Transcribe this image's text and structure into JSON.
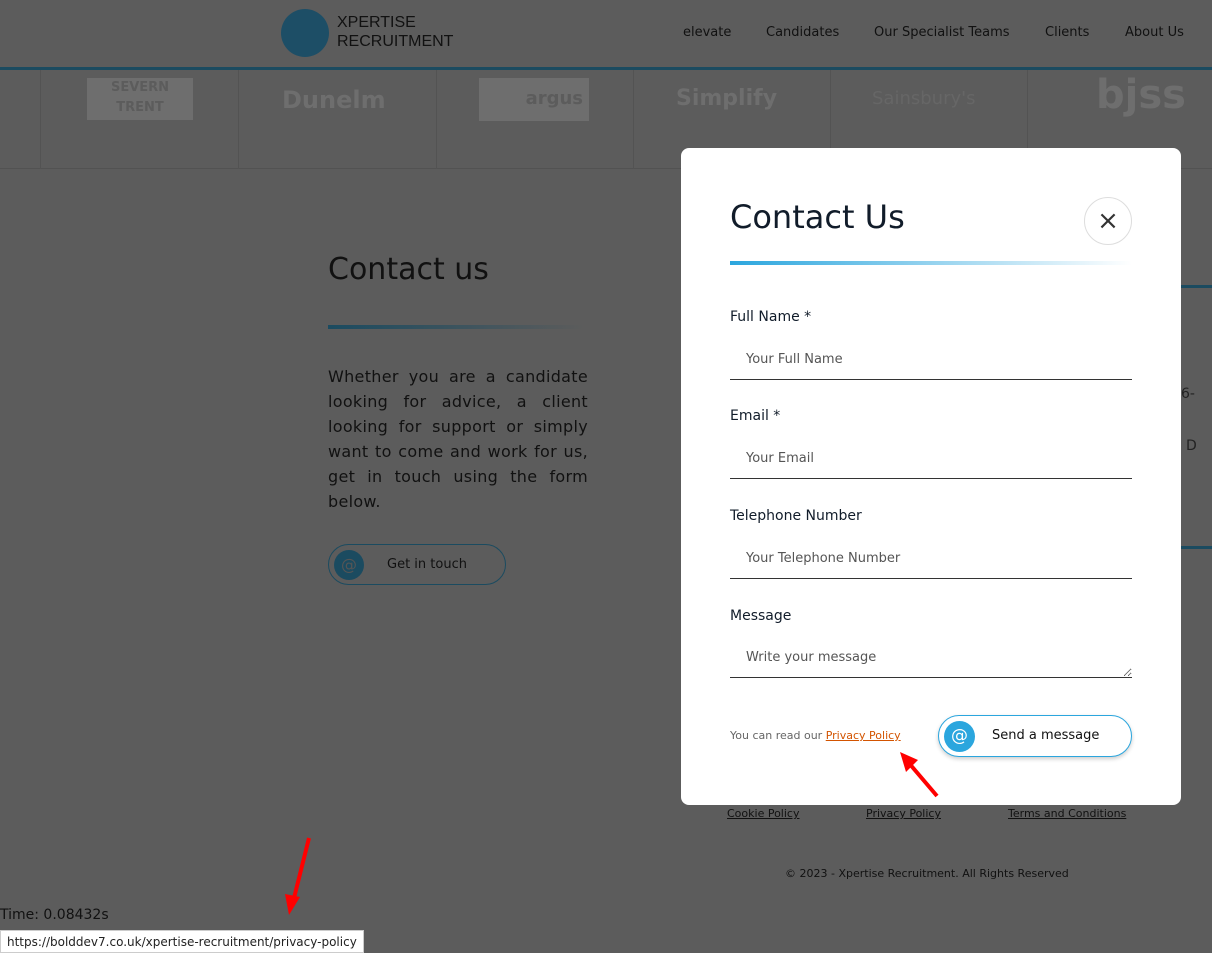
{
  "header": {
    "logo_line1": "XPERTISE",
    "logo_line2": "RECRUITMENT",
    "nav": [
      "elevate",
      "Candidates",
      "Our Specialist Teams",
      "Clients",
      "About Us"
    ]
  },
  "client_logos": [
    "SEVERN TRENT",
    "Dunelm",
    "argus",
    "Simplify",
    "Sainsbury's",
    "bjss"
  ],
  "page": {
    "title": "Contact us",
    "intro": "Whether you are a candidate looking for advice, a client looking for support or simply want to come and work for us, get in touch using the form below.",
    "cta": "Get in touch",
    "side_fragment_1": "6-",
    "side_fragment_2": "D"
  },
  "modal": {
    "title": "Contact Us",
    "close_icon": "×",
    "fields": [
      {
        "label": "Full Name *",
        "placeholder": "Your Full Name"
      },
      {
        "label": "Email *",
        "placeholder": "Your Email"
      },
      {
        "label": "Telephone Number",
        "placeholder": "Your Telephone Number"
      },
      {
        "label": "Message",
        "placeholder": "Write your message"
      }
    ],
    "privacy_prefix": "You can read our",
    "privacy_link": "Privacy Policy",
    "send": "Send a message"
  },
  "footer": {
    "links": [
      "Cookie Policy",
      "Privacy Policy",
      "Terms and Conditions"
    ],
    "copyright": "© 2023 - Xpertise Recruitment. All Rights Reserved"
  },
  "debug": {
    "time": "Time: 0.08432s"
  },
  "status_bar": {
    "url": "https://bolddev7.co.uk/xpertise-recruitment/privacy-policy"
  },
  "colors": {
    "accent": "#2ba6de",
    "link": "#d35400",
    "annotation": "#ff0000"
  }
}
